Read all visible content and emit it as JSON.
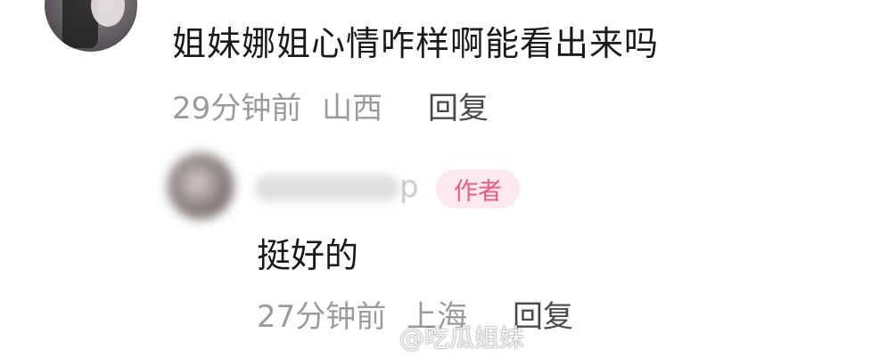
{
  "comment1": {
    "text": "姐妹娜姐心情咋样啊能看出来吗",
    "time": "29分钟前",
    "location": "山西",
    "reply_label": "回复"
  },
  "comment2": {
    "username_visible_tail": "p",
    "author_badge": "作者",
    "text": "挺好的",
    "time": "27分钟前",
    "location": "上海",
    "reply_label": "回复"
  },
  "watermark": {
    "text": "@吃瓜姐妹",
    "icon": "weibo-logo"
  },
  "colors": {
    "author_badge_text": "#ef5b7f",
    "author_badge_bg": "#fde9ee",
    "meta_text": "#9b9b9b",
    "body_text": "#1a1a1a"
  }
}
